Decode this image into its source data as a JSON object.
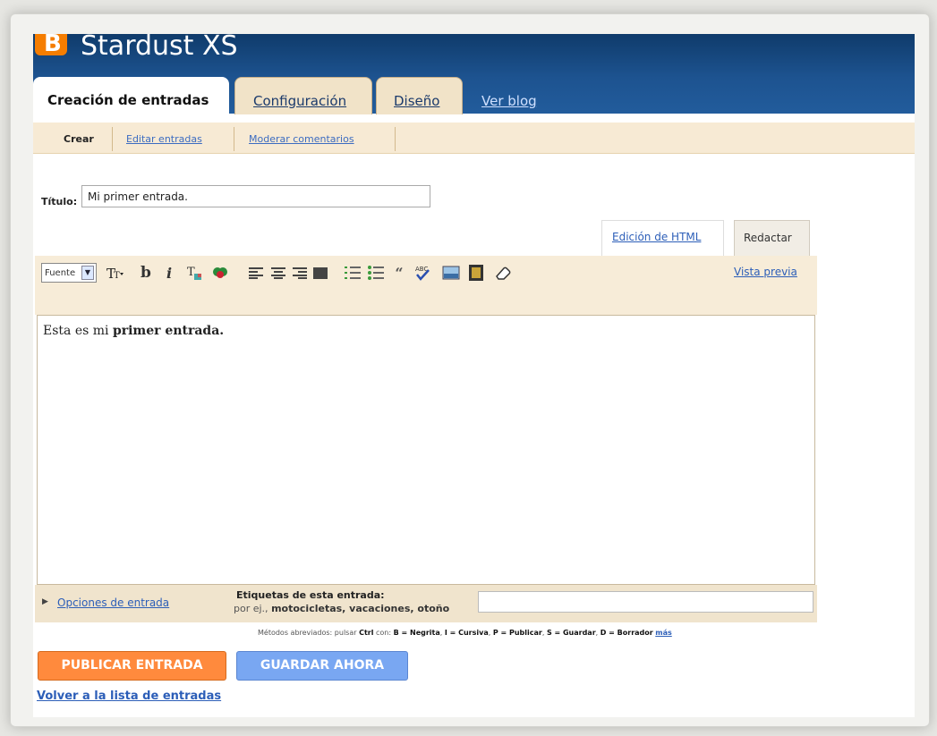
{
  "header": {
    "blog_title": "Stardust XS",
    "tabs": [
      {
        "label": "Creación de entradas"
      },
      {
        "label": "Configuración"
      },
      {
        "label": "Diseño"
      },
      {
        "label": "Ver blog"
      }
    ]
  },
  "subnav": {
    "items": [
      {
        "label": "Crear"
      },
      {
        "label": "Editar entradas"
      },
      {
        "label": "Moderar comentarios"
      }
    ]
  },
  "form": {
    "title_label": "Título:",
    "title_value": "Mi primer entrada."
  },
  "editor": {
    "mode_html": "Edición de HTML",
    "mode_compose": "Redactar",
    "font_select": "Fuente",
    "preview": "Vista previa",
    "content_normal": "Esta es mi ",
    "content_bold": "primer entrada."
  },
  "options": {
    "link": "Opciones de entrada",
    "tags_title": "Etiquetas de esta entrada:",
    "tags_example_prefix": "por ej.,",
    "tags_example": "motocicletas, vacaciones, otoño",
    "tags_value": ""
  },
  "shortcuts": {
    "prefix": "Métodos abreviados: pulsar",
    "ctrl": "Ctrl",
    "con": "con:",
    "b": "B = Negrita",
    "i": "I = Cursiva",
    "p": "P = Publicar",
    "s": "S = Guardar",
    "d": "D = Borrador",
    "more": "más"
  },
  "buttons": {
    "publish": "PUBLICAR ENTRADA",
    "save": "GUARDAR AHORA",
    "back": "Volver a la lista de entradas"
  },
  "colors": {
    "header": "#1d5390",
    "publish": "#ff8a3d",
    "save": "#79a7f2",
    "link": "#2c5eb8"
  }
}
